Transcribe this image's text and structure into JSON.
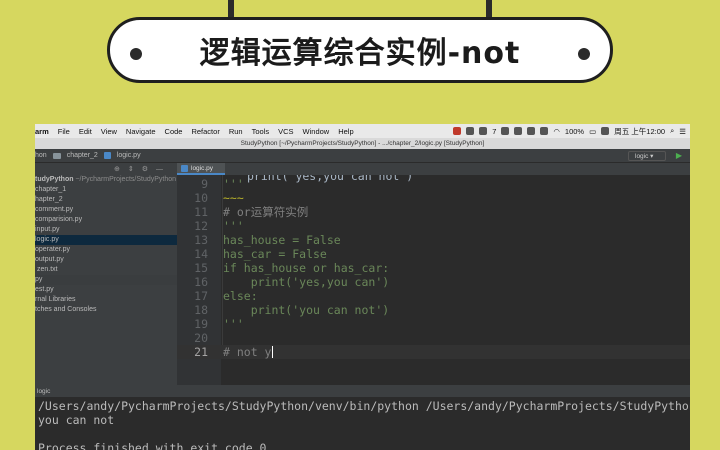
{
  "title": "逻辑运算综合实例-not",
  "menubar": {
    "app": "arm",
    "items": [
      "File",
      "Edit",
      "View",
      "Navigate",
      "Code",
      "Refactor",
      "Run",
      "Tools",
      "VCS",
      "Window",
      "Help"
    ],
    "battery": "100%",
    "clock": "周五 上午12:00",
    "badge": "7"
  },
  "window_title": "StudyPython [~/PycharmProjects/StudyPython] - .../chapter_2/logic.py [StudyPython]",
  "breadcrumb": {
    "root": "hon",
    "folder": "chapter_2",
    "file": "logic.py"
  },
  "run_config": "logic",
  "project": {
    "root": "tudyPython",
    "root_path": "~/PycharmProjects/StudyPython",
    "items": [
      {
        "label": "chapter_1"
      },
      {
        "label": "hapter_2"
      },
      {
        "label": "comment.py"
      },
      {
        "label": "comparision.py"
      },
      {
        "label": "input.py"
      },
      {
        "label": "logic.py",
        "selected": true
      },
      {
        "label": "operater.py"
      },
      {
        "label": "output.py"
      },
      {
        "label": "zen.txt"
      },
      {
        "label": "py"
      },
      {
        "label": "est.py"
      },
      {
        "label": "rnal Libraries"
      },
      {
        "label": "tches and Consoles"
      }
    ]
  },
  "editor": {
    "tab": "logic.py",
    "top_partial": "print('yes,you can not')",
    "lines": [
      {
        "n": "9",
        "text": "'''"
      },
      {
        "n": "10",
        "text": ""
      },
      {
        "n": "11",
        "text": "# or运算符实例"
      },
      {
        "n": "12",
        "text": "'''"
      },
      {
        "n": "13",
        "text": "has_house = False"
      },
      {
        "n": "14",
        "text": "has_car = False"
      },
      {
        "n": "15",
        "text": "if has_house or has_car:"
      },
      {
        "n": "16",
        "text": "    print('yes,you can')"
      },
      {
        "n": "17",
        "text": "else:"
      },
      {
        "n": "18",
        "text": "    print('you can not')"
      },
      {
        "n": "19",
        "text": "'''"
      },
      {
        "n": "20",
        "text": ""
      },
      {
        "n": "21",
        "text": "# not y"
      }
    ]
  },
  "run": {
    "tab": "logic",
    "output": [
      "/Users/andy/PycharmProjects/StudyPython/venv/bin/python /Users/andy/PycharmProjects/StudyPython/ch",
      "you can not",
      "",
      "Process finished with exit code 0"
    ]
  }
}
